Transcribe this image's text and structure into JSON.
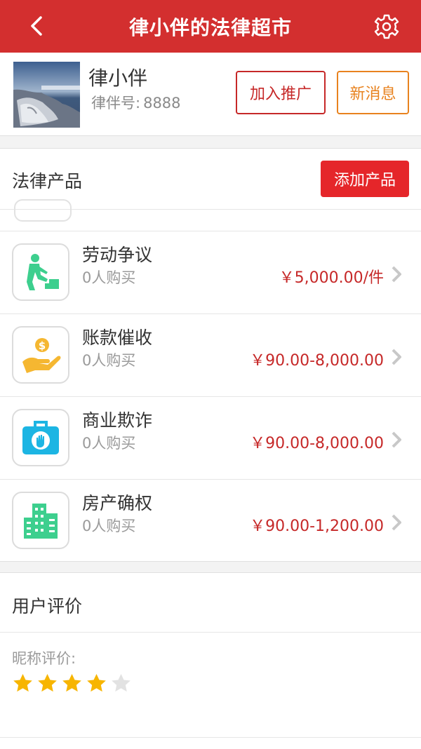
{
  "header": {
    "title": "律小伴的法律超市"
  },
  "profile": {
    "name": "律小伴",
    "id_label": "律伴号:",
    "id_value": "8888",
    "promote_label": "加入推广",
    "messages_label": "新消息"
  },
  "products": {
    "section_label": "法律产品",
    "add_label": "添加产品",
    "items": [
      {
        "title": "劳动争议",
        "sales": "0人购买",
        "price": "￥5,000.00/件",
        "icon": "worker-icon",
        "icon_color": "#3dcf8e"
      },
      {
        "title": "账款催收",
        "sales": "0人购买",
        "price": "￥90.00-8,000.00",
        "icon": "money-hand-icon",
        "icon_color": "#f5b731"
      },
      {
        "title": "商业欺诈",
        "sales": "0人购买",
        "price": "￥90.00-8,000.00",
        "icon": "briefcase-stop-icon",
        "icon_color": "#1cb5e3"
      },
      {
        "title": "房产确权",
        "sales": "0人购买",
        "price": "￥90.00-1,200.00",
        "icon": "buildings-icon",
        "icon_color": "#3dcf8e"
      }
    ]
  },
  "reviews": {
    "section_label": "用户评价",
    "reviewer_label": "昵称评价:",
    "rating": 4,
    "rating_max": 5,
    "star_color": "#f7b500"
  },
  "colors": {
    "brand_red": "#d32f2f",
    "price_red": "#c62828",
    "orange": "#e8821e"
  }
}
